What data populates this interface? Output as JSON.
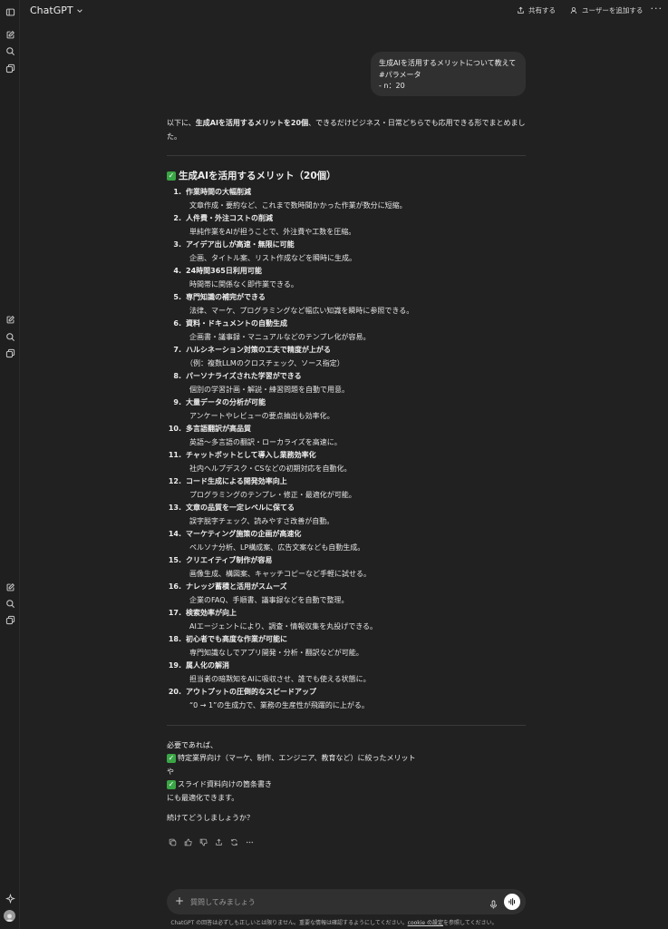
{
  "app": {
    "title": "ChatGPT",
    "share_label": "共有する",
    "add_user_label": "ユーザーを追加する",
    "more_label": "···"
  },
  "sidebar": {
    "icons": [
      "sidebar-toggle-icon",
      "new-chat-icon",
      "search-icon",
      "library-icon",
      "new-chat-icon",
      "search-icon",
      "library-icon",
      "new-chat-icon",
      "search-icon",
      "library-icon",
      "sparkle-icon"
    ]
  },
  "user_message": {
    "lines": [
      "生成AIを活用するメリットについて教えて",
      "#パラメータ",
      "- n：20"
    ]
  },
  "answer": {
    "intro_prefix": "以下に、",
    "intro_bold": "生成AIを活用するメリットを20個",
    "intro_suffix": "、できるだけビジネス・日常どちらでも応用できる形でまとめました。",
    "heading": "生成AIを活用するメリット（20個）",
    "items": [
      {
        "num": "1.",
        "title": "作業時間の大幅削減",
        "desc": "文章作成・要約など、これまで数時間かかった作業が数分に短縮。"
      },
      {
        "num": "2.",
        "title": "人件費・外注コストの削減",
        "desc": "単純作業をAIが担うことで、外注費や工数を圧縮。"
      },
      {
        "num": "3.",
        "title": "アイデア出しが高速・無限に可能",
        "desc": "企画、タイトル案、リスト作成などを瞬時に生成。"
      },
      {
        "num": "4.",
        "title": "24時間365日利用可能",
        "desc": "時間帯に関係なく即作業できる。"
      },
      {
        "num": "5.",
        "title": "専門知識の補完ができる",
        "desc": "法律、マーケ、プログラミングなど幅広い知識を瞬時に参照できる。"
      },
      {
        "num": "6.",
        "title": "資料・ドキュメントの自動生成",
        "desc": "企画書・議事録・マニュアルなどのテンプレ化が容易。"
      },
      {
        "num": "7.",
        "title": "ハルシネーション対策の工夫で精度が上がる",
        "desc": "（例：複数LLMのクロスチェック、ソース指定）"
      },
      {
        "num": "8.",
        "title": "パーソナライズされた学習ができる",
        "desc": "個別の学習計画・解説・練習問題を自動で用意。"
      },
      {
        "num": "9.",
        "title": "大量データの分析が可能",
        "desc": "アンケートやレビューの要点抽出も効率化。"
      },
      {
        "num": "10.",
        "title": "多言語翻訳が高品質",
        "desc": "英語〜多言語の翻訳・ローカライズを高速に。"
      },
      {
        "num": "11.",
        "title": "チャットボットとして導入し業務効率化",
        "desc": "社内ヘルプデスク・CSなどの初期対応を自動化。"
      },
      {
        "num": "12.",
        "title": "コード生成による開発効率向上",
        "desc": "プログラミングのテンプレ・修正・最適化が可能。"
      },
      {
        "num": "13.",
        "title": "文章の品質を一定レベルに保てる",
        "desc": "誤字脱字チェック、読みやすさ改善が自動。"
      },
      {
        "num": "14.",
        "title": "マーケティング施策の企画が高速化",
        "desc": "ペルソナ分析、LP構成案、広告文案なども自動生成。"
      },
      {
        "num": "15.",
        "title": "クリエイティブ制作が容易",
        "desc": "画像生成、構図案、キャッチコピーなど手軽に試せる。"
      },
      {
        "num": "16.",
        "title": "ナレッジ蓄積と活用がスムーズ",
        "desc": "企業のFAQ、手順書、議事録などを自動で整理。"
      },
      {
        "num": "17.",
        "title": "検索効率が向上",
        "desc": "AIエージェントにより、調査・情報収集を丸投げできる。"
      },
      {
        "num": "18.",
        "title": "初心者でも高度な作業が可能に",
        "desc": "専門知識なしでアプリ開発・分析・翻訳などが可能。"
      },
      {
        "num": "19.",
        "title": "属人化の解消",
        "desc": "担当者の暗黙知をAIに吸収させ、誰でも使える状態に。"
      },
      {
        "num": "20.",
        "title": "アウトプットの圧倒的なスピードアップ",
        "desc": "“0 → 1”の生成力で、業務の生産性が飛躍的に上がる。"
      }
    ],
    "outro": {
      "line1": "必要であれば、",
      "line2": "特定業界向け（マーケ、制作、エンジニア、教育など）に絞ったメリット",
      "line3": "や",
      "line4": "スライド資料向けの箇条書き",
      "line5": "にも最適化できます。",
      "line6": "続けてどうしましょうか？"
    }
  },
  "composer": {
    "placeholder": "質問してみましょう"
  },
  "footer": {
    "disclaimer_prefix": "ChatGPT の回答は必ずしも正しいとは限りません。重要な情報は確認するようにしてください。",
    "cookie_link": "cookie の設定",
    "disclaimer_suffix": "を参照してください。"
  }
}
